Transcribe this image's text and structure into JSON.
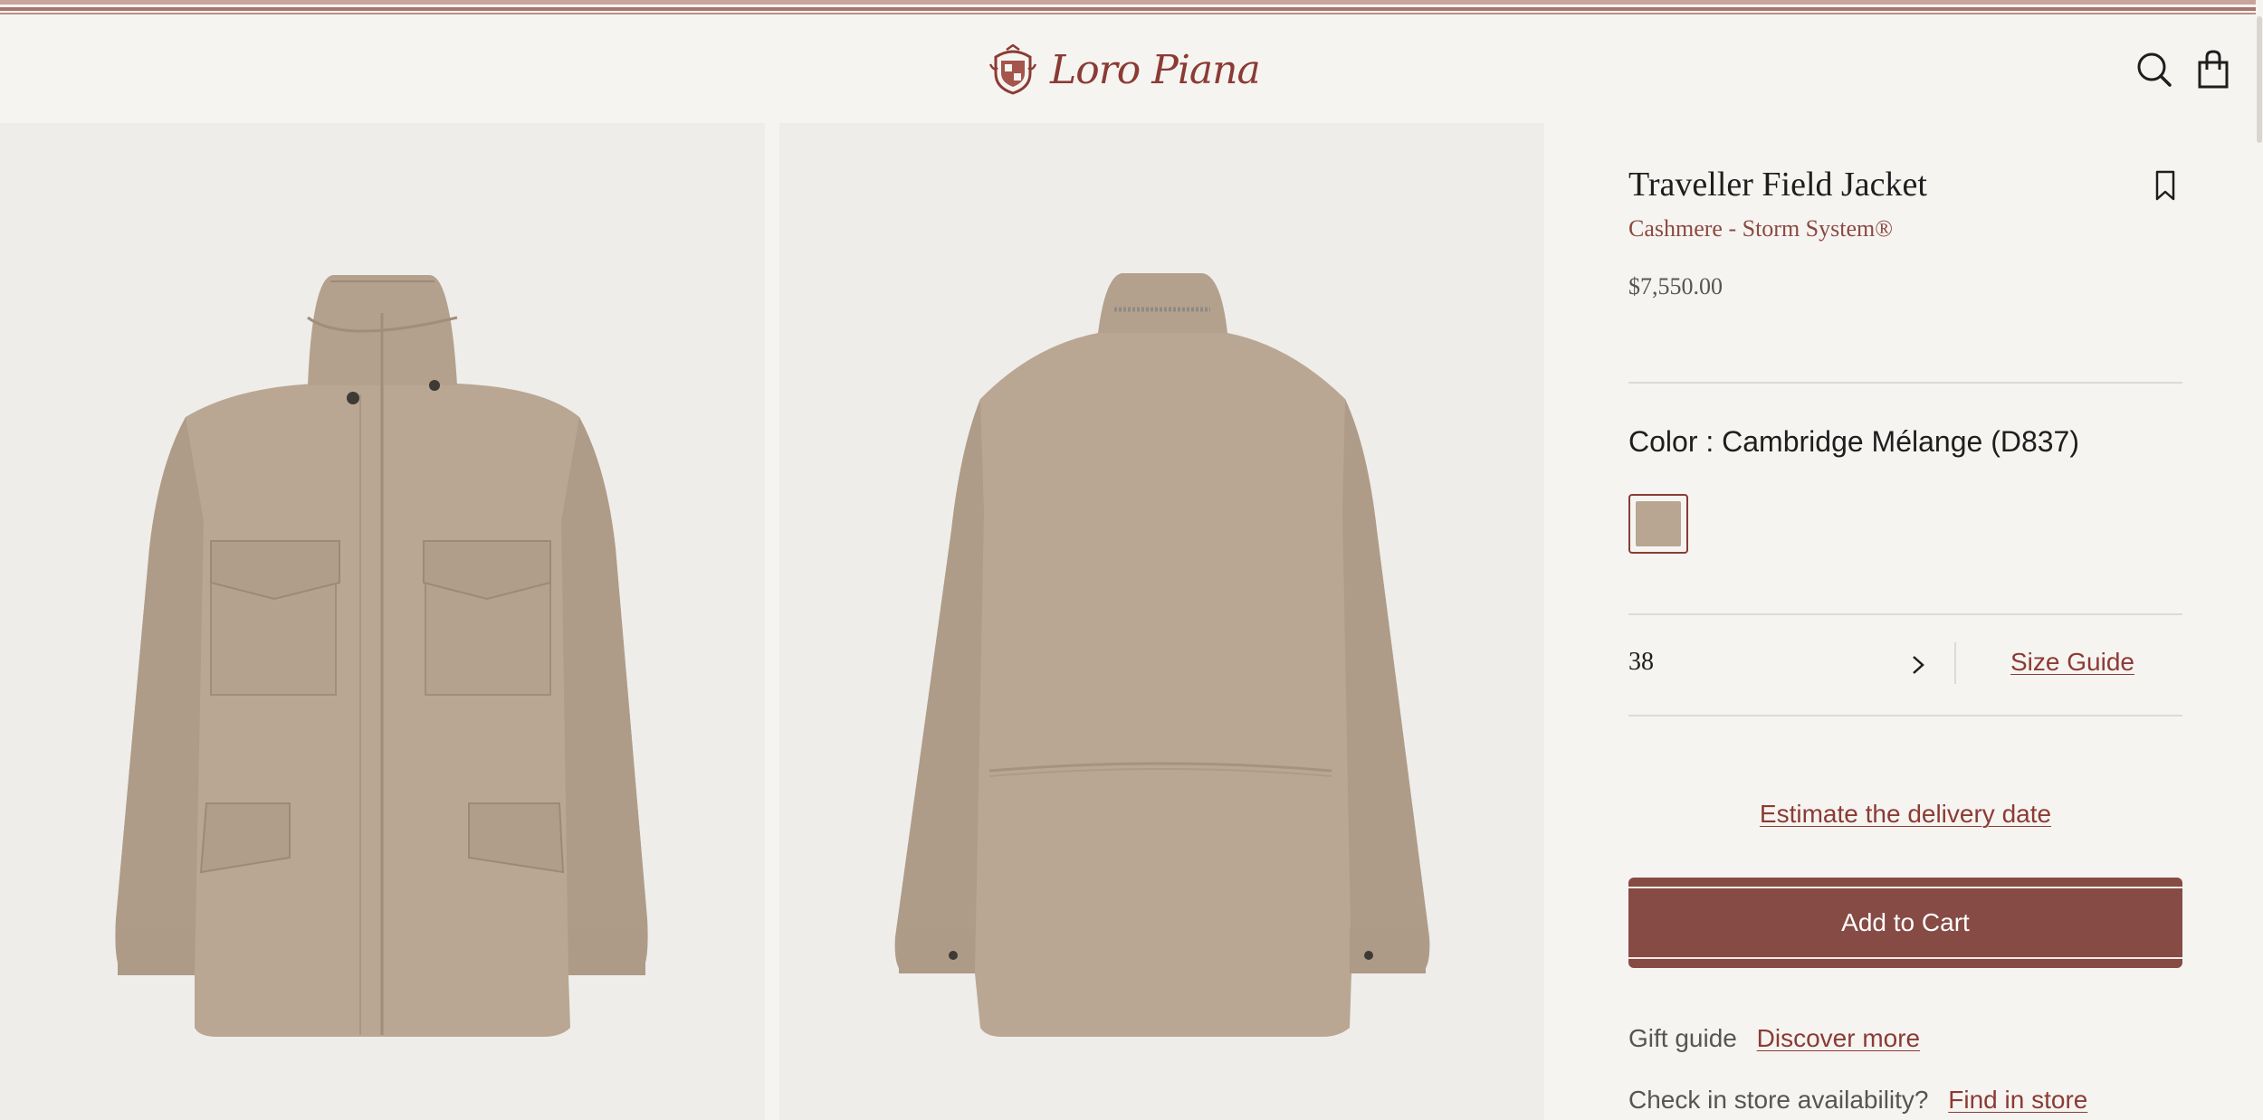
{
  "header": {
    "logo_text": "Loro Piana",
    "icons": {
      "search": "search-icon",
      "bag": "shopping-bag-icon",
      "crest": "crest-logo-icon"
    }
  },
  "gallery": {
    "images": [
      {
        "view": "front",
        "icon": "jacket-front-image"
      },
      {
        "view": "back",
        "icon": "jacket-back-image"
      }
    ]
  },
  "product": {
    "title": "Traveller Field Jacket",
    "subtitle": "Cashmere - Storm System®",
    "price": "$7,550.00",
    "wishlist_icon": "bookmark-icon"
  },
  "color": {
    "label": "Color : Cambridge Mélange (D837)",
    "swatch_color": "#b8a693",
    "selected": true
  },
  "size": {
    "value": "38",
    "chevron_icon": "chevron-right-icon",
    "guide_label": "Size Guide"
  },
  "delivery": {
    "label": "Estimate the delivery date"
  },
  "cart": {
    "button_label": "Add to Cart"
  },
  "gift": {
    "text": "Gift guide",
    "link": "Discover more"
  },
  "store": {
    "text": "Check in store availability?",
    "link": "Find in store"
  },
  "colors": {
    "brand": "#8b3b34",
    "button": "#864b44",
    "background": "#f6f4f1",
    "jacket": "#b8a693"
  }
}
